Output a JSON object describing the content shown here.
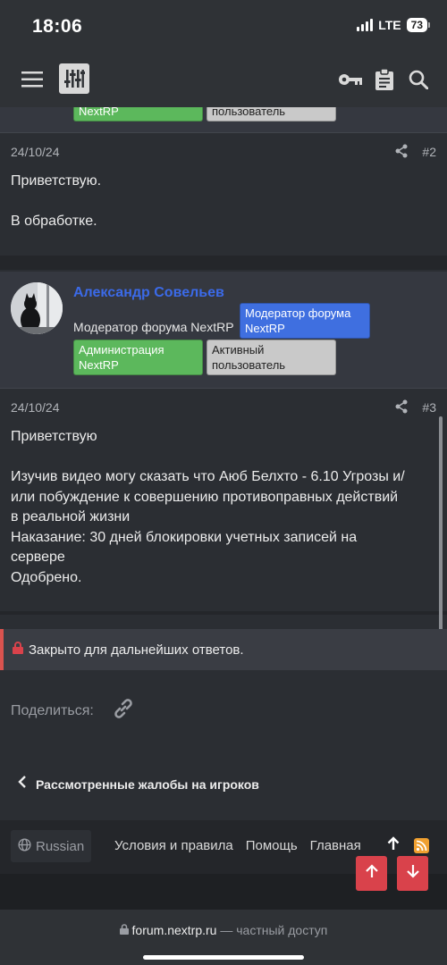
{
  "status": {
    "time": "18:06",
    "network": "LTE",
    "battery": "73"
  },
  "nav": {
    "menu_icon": "hamburger-icon",
    "logo_icon": "sliders-icon",
    "key_icon": "key-icon",
    "clipboard_icon": "clipboard-icon",
    "search_icon": "search-icon"
  },
  "partial_post": {
    "badge_green": "NextRP",
    "badge_gray": "пользователь"
  },
  "post2": {
    "date": "24/10/24",
    "number": "#2",
    "lines": [
      "Приветствую.",
      "",
      "В обработке."
    ]
  },
  "user3": {
    "name": "Александр Совельев",
    "title": "Модератор форума NextRP",
    "badges": [
      {
        "line1": "Модератор форума",
        "line2": "NextRP"
      },
      {
        "line1": "Администрация",
        "line2": "NextRP"
      },
      {
        "line1": "Активный",
        "line2": "пользователь"
      }
    ]
  },
  "post3": {
    "date": "24/10/24",
    "number": "#3",
    "lines": [
      "Приветствую",
      "",
      "Изучив видео могу сказать что Аюб Белхто - 6.10 Угрозы и/",
      "или побуждение к совершению противоправных действий",
      "в реальной жизни",
      "Наказание: 30 дней блокировки учетных записей на",
      "сервере",
      "Одобрено."
    ]
  },
  "closed": {
    "text": "Закрыто для дальнейших ответов."
  },
  "share": {
    "label": "Поделиться:"
  },
  "back": {
    "label": "Рассмотренные жалобы на игроков"
  },
  "footer": {
    "language": "Russian",
    "links": [
      "Условия и правила",
      "Помощь",
      "Главная"
    ]
  },
  "browser": {
    "url": "forum.nextrp.ru",
    "note": " — частный доступ"
  },
  "colors": {
    "accent_blue": "#3b6ae8",
    "red": "#d9424b",
    "green": "#5cb85c"
  }
}
